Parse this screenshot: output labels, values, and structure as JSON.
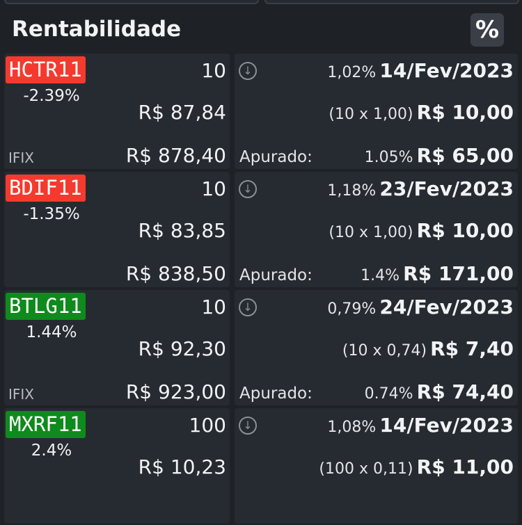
{
  "header": {
    "title": "Rentabilidade",
    "toggle_icon": "percent-icon",
    "toggle_glyph": "%"
  },
  "icons": {
    "download": "↓"
  },
  "rows": [
    {
      "ticker": "HCTR11",
      "ticker_color": "#f43a2e",
      "change": "-2.39%",
      "quantity": "10",
      "price": "R$ 87,84",
      "index": "IFIX",
      "total": "R$ 878,40",
      "yield_pct": "1,02%",
      "date": "14/Fev/2023",
      "calc": "(10 x 1,00)",
      "dividend": "R$ 10,00",
      "apurado_label": "Apurado:",
      "apurado_pct": "1.05%",
      "apurado_total": "R$ 65,00"
    },
    {
      "ticker": "BDIF11",
      "ticker_color": "#f43a2e",
      "change": "-1.35%",
      "quantity": "10",
      "price": "R$ 83,85",
      "index": "",
      "total": "R$ 838,50",
      "yield_pct": "1,18%",
      "date": "23/Fev/2023",
      "calc": "(10 x 1,00)",
      "dividend": "R$ 10,00",
      "apurado_label": "Apurado:",
      "apurado_pct": "1.4%",
      "apurado_total": "R$ 171,00"
    },
    {
      "ticker": "BTLG11",
      "ticker_color": "#0f8a1c",
      "change": "1.44%",
      "quantity": "10",
      "price": "R$ 92,30",
      "index": "IFIX",
      "total": "R$ 923,00",
      "yield_pct": "0,79%",
      "date": "24/Fev/2023",
      "calc": "(10 x 0,74)",
      "dividend": "R$ 7,40",
      "apurado_label": "Apurado:",
      "apurado_pct": "0.74%",
      "apurado_total": "R$ 74,40"
    },
    {
      "ticker": "MXRF11",
      "ticker_color": "#0f8a1c",
      "change": "2.4%",
      "quantity": "100",
      "price": "R$ 10,23",
      "index": "",
      "total": "",
      "yield_pct": "1,08%",
      "date": "14/Fev/2023",
      "calc": "(100 x 0,11)",
      "dividend": "R$ 11,00",
      "apurado_label": "",
      "apurado_pct": "",
      "apurado_total": ""
    }
  ]
}
